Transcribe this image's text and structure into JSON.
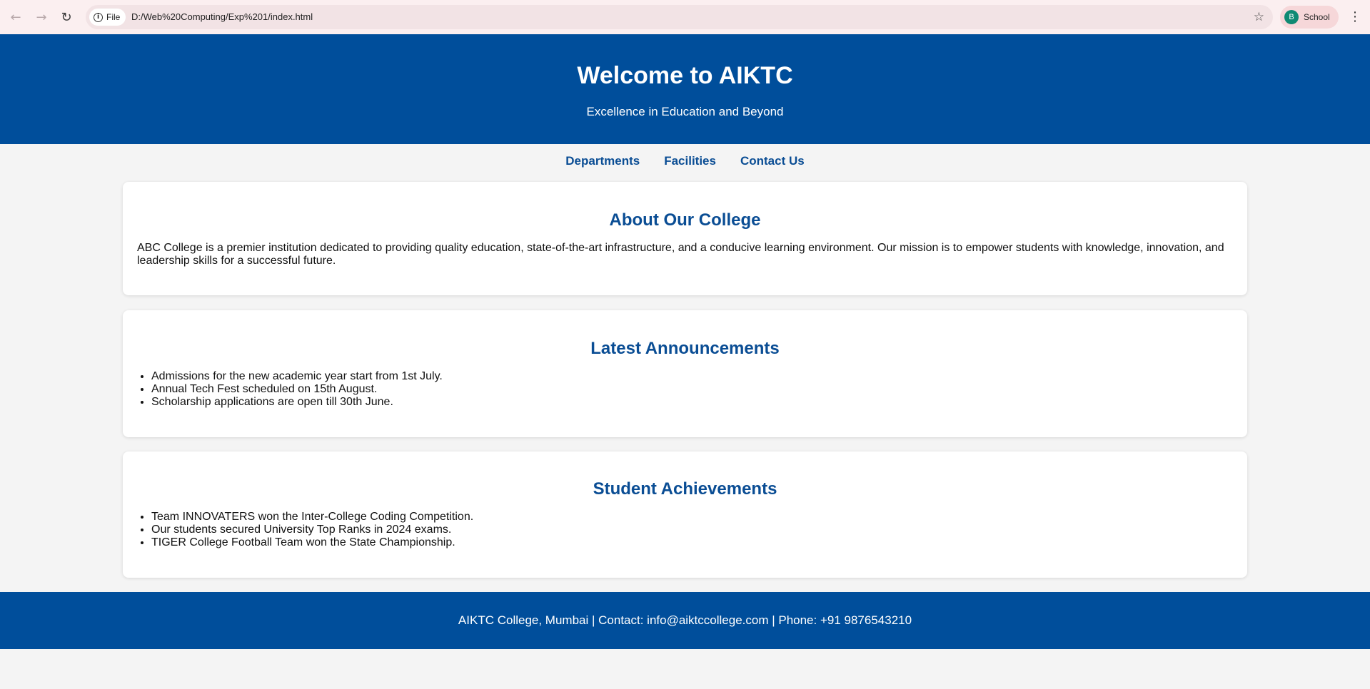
{
  "browser": {
    "site_chip_label": "File",
    "url": "D:/Web%20Computing/Exp%201/index.html",
    "profile_initial": "B",
    "profile_label": "School"
  },
  "header": {
    "title": "Welcome to AIKTC",
    "tagline": "Excellence in Education and Beyond"
  },
  "nav": {
    "items": [
      "Departments",
      "Facilities",
      "Contact Us"
    ]
  },
  "about": {
    "heading": "About Our College",
    "text": "ABC College is a premier institution dedicated to providing quality education, state-of-the-art infrastructure, and a conducive learning environment. Our mission is to empower students with knowledge, innovation, and leadership skills for a successful future."
  },
  "announcements": {
    "heading": "Latest Announcements",
    "items": [
      "Admissions for the new academic year start from 1st July.",
      "Annual Tech Fest scheduled on 15th August.",
      "Scholarship applications are open till 30th June."
    ]
  },
  "achievements": {
    "heading": "Student Achievements",
    "items": [
      "Team INNOVATERS won the Inter-College Coding Competition.",
      "Our students secured University Top Ranks in 2024 exams.",
      "TIGER College Football Team won the State Championship."
    ]
  },
  "footer": {
    "text": "AIKTC College, Mumbai | Contact: info@aiktccollege.com | Phone: +91 9876543210"
  },
  "colors": {
    "primary": "#004e9b",
    "link": "#0a4d94",
    "page_bg": "#f4f4f4"
  }
}
